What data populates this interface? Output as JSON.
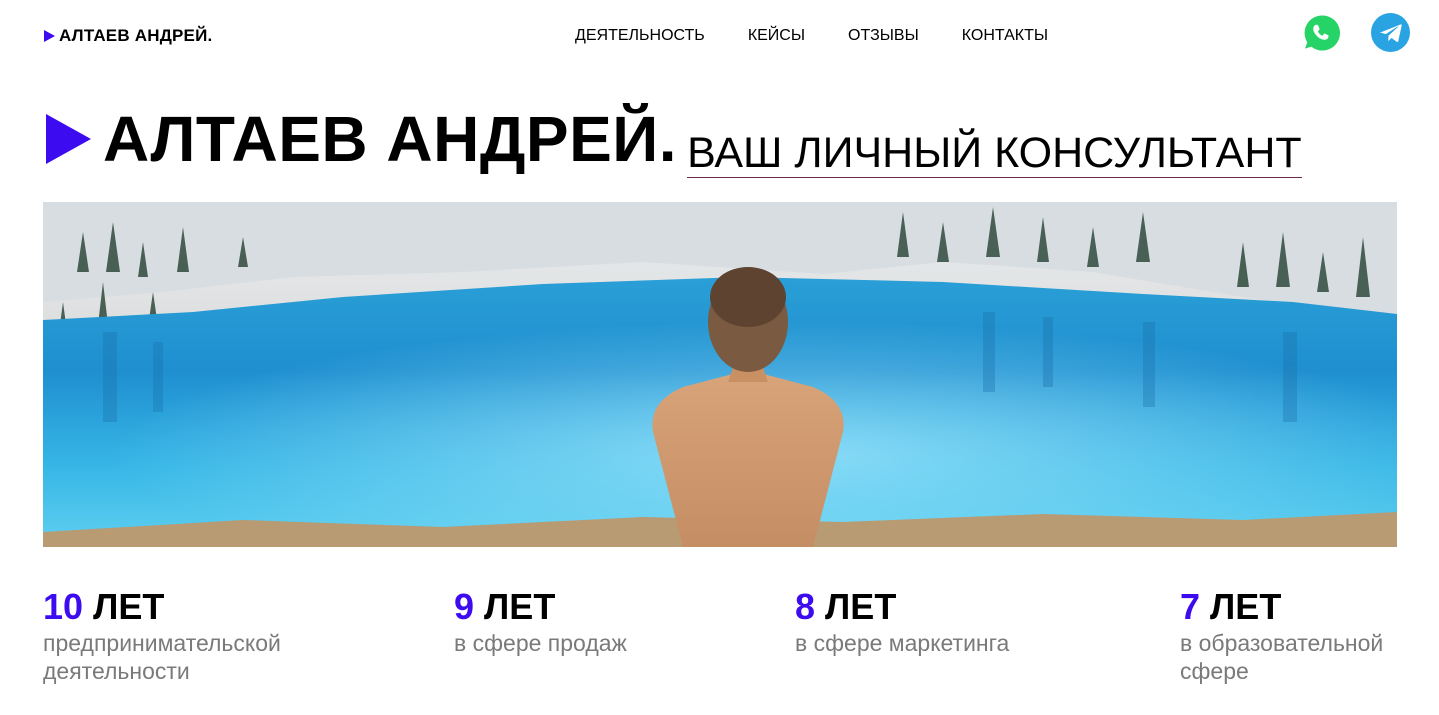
{
  "header": {
    "logo": "АЛТАЕВ АНДРЕЙ.",
    "nav": [
      "ДЕЯТЕЛЬНОСТЬ",
      "КЕЙСЫ",
      "ОТЗЫВЫ",
      "КОНТАКТЫ"
    ],
    "social": [
      {
        "icon": "whatsapp-icon",
        "color": "#25d366"
      },
      {
        "icon": "telegram-icon",
        "color": "#2aa3e2"
      }
    ]
  },
  "hero": {
    "name": "АЛТАЕВ АНДРЕЙ.",
    "subtitle": "ВАШ ЛИЧНЫЙ КОНСУЛЬТАНТ"
  },
  "stats": [
    {
      "number": "10",
      "unit": "ЛЕТ",
      "description": "предпринимательской деятельности"
    },
    {
      "number": "9",
      "unit": "ЛЕТ",
      "description": "в сфере продаж"
    },
    {
      "number": "8",
      "unit": "ЛЕТ",
      "description": "в сфере маркетинга"
    },
    {
      "number": "7",
      "unit": "ЛЕТ",
      "description": "в образовательной сфере"
    }
  ],
  "colors": {
    "accent": "#3d0bf0",
    "muted_text": "#7a7a7a"
  }
}
